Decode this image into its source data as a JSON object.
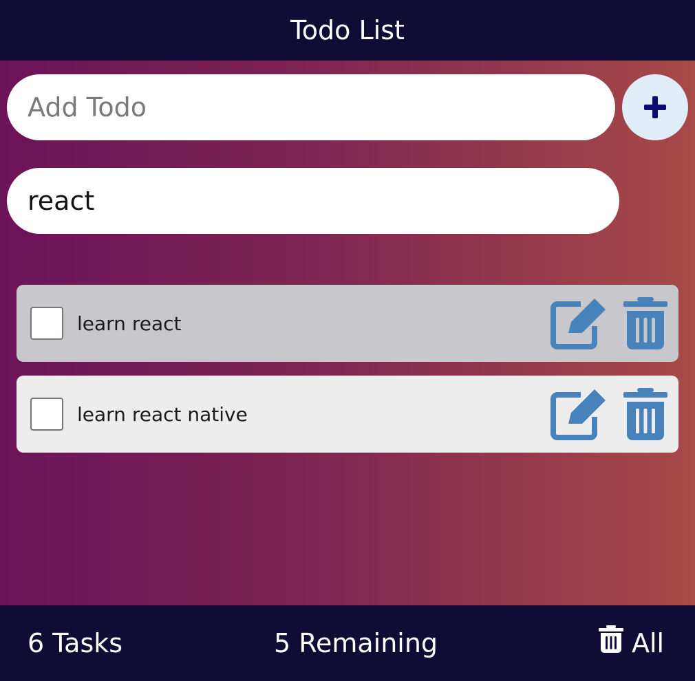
{
  "header": {
    "title": "Todo List"
  },
  "add_form": {
    "placeholder": "Add Todo",
    "value": "",
    "button_icon": "plus-icon"
  },
  "search": {
    "value": "react"
  },
  "todos": [
    {
      "text": "learn react",
      "checked": false
    },
    {
      "text": "learn react native",
      "checked": false
    }
  ],
  "footer": {
    "tasks_label": "6 Tasks",
    "remaining_label": "5 Remaining",
    "clear_label": "All",
    "clear_icon": "trash-icon"
  },
  "colors": {
    "header_bg": "#100c36",
    "gradient_start": "#6c1259",
    "gradient_end": "#a74a48",
    "icon_blue": "#4782bb",
    "add_button_bg": "#e1edf8",
    "add_icon": "#0c0c6e",
    "row_selected_bg": "#c8c7cc",
    "row_bg": "#ededee"
  }
}
